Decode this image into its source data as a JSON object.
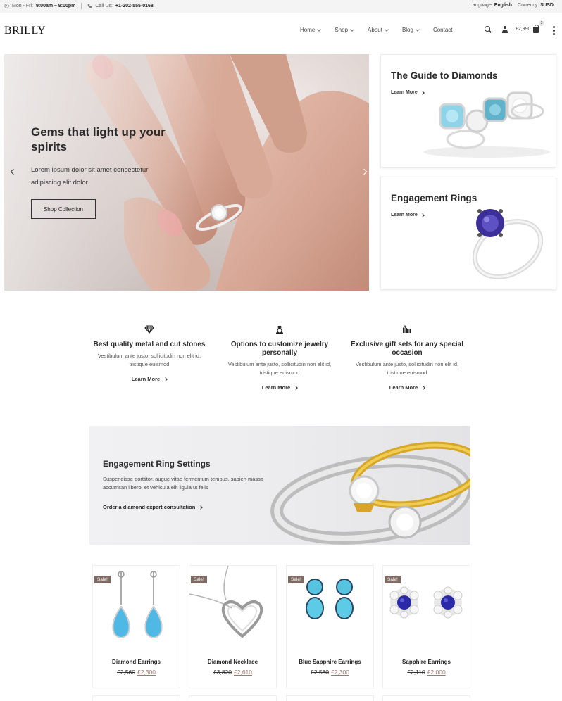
{
  "topbar": {
    "hours_label": "Mon - Fri:",
    "hours_value": "9:00am – 9:00pm",
    "phone_label": "Call Us:",
    "phone_value": "+1-202-555-0168",
    "language_label": "Language:",
    "language_value": "English",
    "currency_label": "Currency:",
    "currency_value": "$USD"
  },
  "header": {
    "logo": "BRILLY",
    "nav": [
      "Home",
      "Shop",
      "About",
      "Blog",
      "Contact"
    ],
    "cart_total": "£2,990",
    "cart_count": "2"
  },
  "hero": {
    "title": "Gems that light up your spirits",
    "text": "Lorem ipsum dolor sit amet consectetur adipiscing elit dolor",
    "button": "Shop Collection"
  },
  "promos": [
    {
      "title": "The Guide to Diamonds",
      "link": "Learn More"
    },
    {
      "title": "Engagement Rings",
      "link": "Learn More"
    }
  ],
  "features": [
    {
      "icon": "diamond-icon",
      "title": "Best quality metal and cut stones",
      "text": "Vestibulum ante justo, sollicitudin non elit id, tristique euismod",
      "link": "Learn More"
    },
    {
      "icon": "ring-icon",
      "title": "Options to customize jewelry personally",
      "text": "Vestibulum ante justo, sollicitudin non elit id, tristique euismod",
      "link": "Learn More"
    },
    {
      "icon": "gift-icon",
      "title": "Exclusive gift sets for any special occasion",
      "text": "Vestibulum ante justo, sollicitudin non elit id, tristique euismod",
      "link": "Learn More"
    }
  ],
  "banner": {
    "title": "Engagement Ring Settings",
    "text": "Suspendisse porttitor, augue vitae fermentum tempus, sapien massa accumsan libero, et vehicula elit ligula ut felis",
    "link": "Order a diamond expert consultation"
  },
  "products": [
    {
      "badge": "Sale!",
      "name": "Diamond Earrings",
      "old_price": "£2,560",
      "new_price": "£2,300"
    },
    {
      "badge": "Sale!",
      "name": "Diamond Necklace",
      "old_price": "£3,820",
      "new_price": "£2,610"
    },
    {
      "badge": "Sale!",
      "name": "Blue Sapphire Earrings",
      "old_price": "£2,560",
      "new_price": "£2,300"
    },
    {
      "badge": "Sale!",
      "name": "Sapphire Earrings",
      "old_price": "£2,110",
      "new_price": "£2,000"
    }
  ],
  "colors": {
    "sale_badge": "#7e6b64",
    "price_new": "#9a7a70",
    "topbar_bg": "#f4f4f4"
  }
}
